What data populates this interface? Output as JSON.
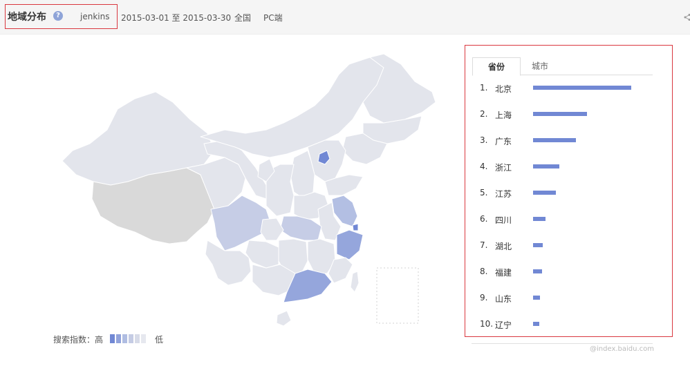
{
  "header": {
    "title": "地域分布",
    "help_icon": "question-icon",
    "keyword": "jenkins",
    "date_range": "2015-03-01 至 2015-03-30",
    "region": "全国",
    "device": "PC端"
  },
  "legend": {
    "label": "搜索指数：",
    "high": "高",
    "low": "低",
    "colors": [
      "#7188d4",
      "#92a3db",
      "#b0bde2",
      "#c5cce4",
      "#d7dbe8",
      "#e6e8ef"
    ]
  },
  "map": {
    "colors": {
      "default": "#e3e5ec",
      "no_data": "#d9d9d9",
      "level1": "#7188d4",
      "level2": "#95a6dc",
      "level3": "#b3bfe3",
      "level4": "#c6cde6"
    }
  },
  "panel": {
    "tabs": [
      {
        "label": "省份",
        "active": true
      },
      {
        "label": "城市",
        "active": false
      }
    ],
    "rankings": [
      {
        "rank": "1.",
        "name": "北京",
        "level": 1.0
      },
      {
        "rank": "2.",
        "name": "上海",
        "level": 0.55
      },
      {
        "rank": "3.",
        "name": "广东",
        "level": 0.44
      },
      {
        "rank": "4.",
        "name": "浙江",
        "level": 0.27
      },
      {
        "rank": "5.",
        "name": "江苏",
        "level": 0.23
      },
      {
        "rank": "6.",
        "name": "四川",
        "level": 0.13
      },
      {
        "rank": "7.",
        "name": "湖北",
        "level": 0.1
      },
      {
        "rank": "8.",
        "name": "福建",
        "level": 0.09
      },
      {
        "rank": "9.",
        "name": "山东",
        "level": 0.07
      },
      {
        "rank": "10.",
        "name": "辽宁",
        "level": 0.06
      }
    ],
    "bar_color": "#7188d4"
  },
  "watermark": "@index.baidu.com"
}
